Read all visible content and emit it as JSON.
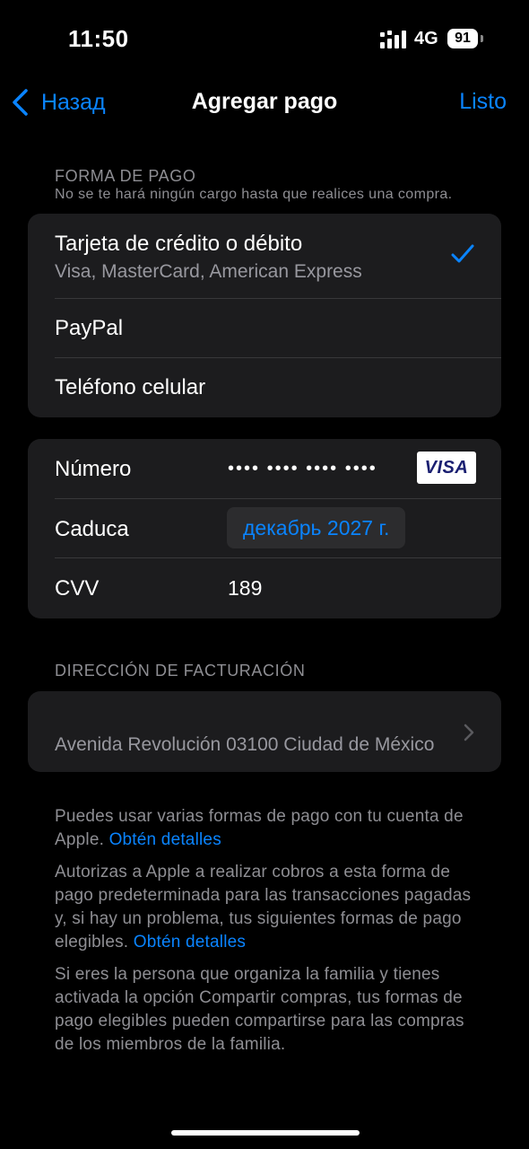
{
  "status_bar": {
    "time": "11:50",
    "network": "4G",
    "battery": "91"
  },
  "nav": {
    "back_label": "Назад",
    "title": "Agregar pago",
    "done_label": "Listo"
  },
  "payment_method": {
    "header": "FORMA DE PAGO",
    "subheader": "No se te hará ningún cargo hasta que realices una compra.",
    "options": [
      {
        "label": "Tarjeta de crédito o débito",
        "sublabel": "Visa, MasterCard, American Express",
        "selected": true
      },
      {
        "label": "PayPal"
      },
      {
        "label": "Teléfono celular"
      }
    ]
  },
  "card_details": {
    "number_label": "Número",
    "number_value": "•••• •••• •••• ••••",
    "card_brand": "VISA",
    "expiry_label": "Caduca",
    "expiry_value": "декабрь 2027 г.",
    "cvv_label": "CVV",
    "cvv_value": "189"
  },
  "billing": {
    "header": "DIRECCIÓN DE FACTURACIÓN",
    "address": "Avenida Revolución 03100 Ciudad de México"
  },
  "footer": {
    "p1_text": "Puedes usar varias formas de pago con tu cuenta de Apple.",
    "p1_link": "Obtén detalles",
    "p2_text": "Autorizas a Apple a realizar cobros a esta forma de pago predeterminada para las transacciones pagadas y, si hay un problema, tus siguientes formas de pago elegibles.",
    "p2_link": "Obtén detalles",
    "p3_text": "Si eres la persona que organiza la familia y tienes activada la opción Compartir compras, tus formas de pago elegibles pueden compartirse para las compras de los miembros de la familia."
  },
  "colors": {
    "background": "#000000",
    "card": "#1c1c1e",
    "accent": "#0a84ff",
    "secondary_text": "#8e8e93"
  }
}
